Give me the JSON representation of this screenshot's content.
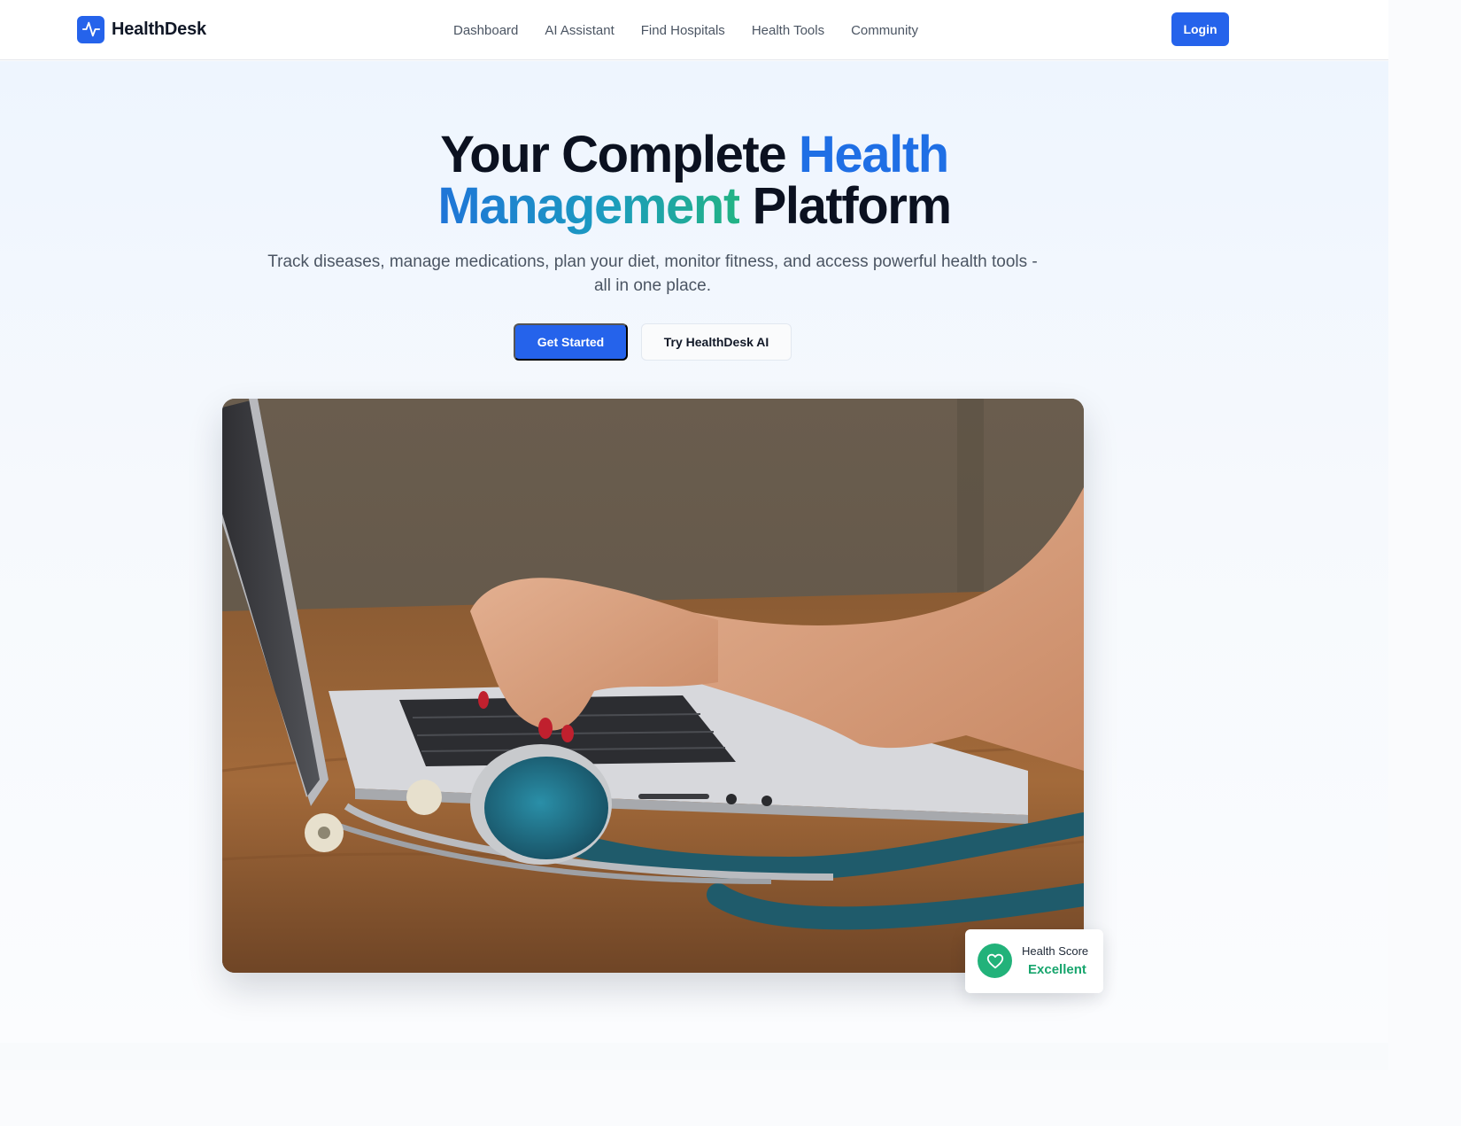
{
  "brand": {
    "name": "HealthDesk",
    "logo_icon": "activity-pulse-icon",
    "color": "#2563eb"
  },
  "nav": {
    "links": [
      "Dashboard",
      "AI Assistant",
      "Find Hospitals",
      "Health Tools",
      "Community"
    ],
    "login_label": "Login"
  },
  "hero": {
    "title_part1": "Your Complete ",
    "title_highlight1": "Health",
    "title_highlight2": "Management",
    "title_part2": " Platform",
    "subtitle": "Track diseases, manage medications, plan your diet, monitor fitness, and access powerful health tools - all in one place.",
    "primary_cta": "Get Started",
    "secondary_cta": "Try HealthDesk AI",
    "image_icon": "laptop-stethoscope-photo"
  },
  "health_score": {
    "label": "Health Score",
    "value": "Excellent",
    "icon": "heart-icon",
    "status_color": "#22b27a"
  },
  "colors": {
    "accent": "#2563eb",
    "success": "#22b27a"
  }
}
